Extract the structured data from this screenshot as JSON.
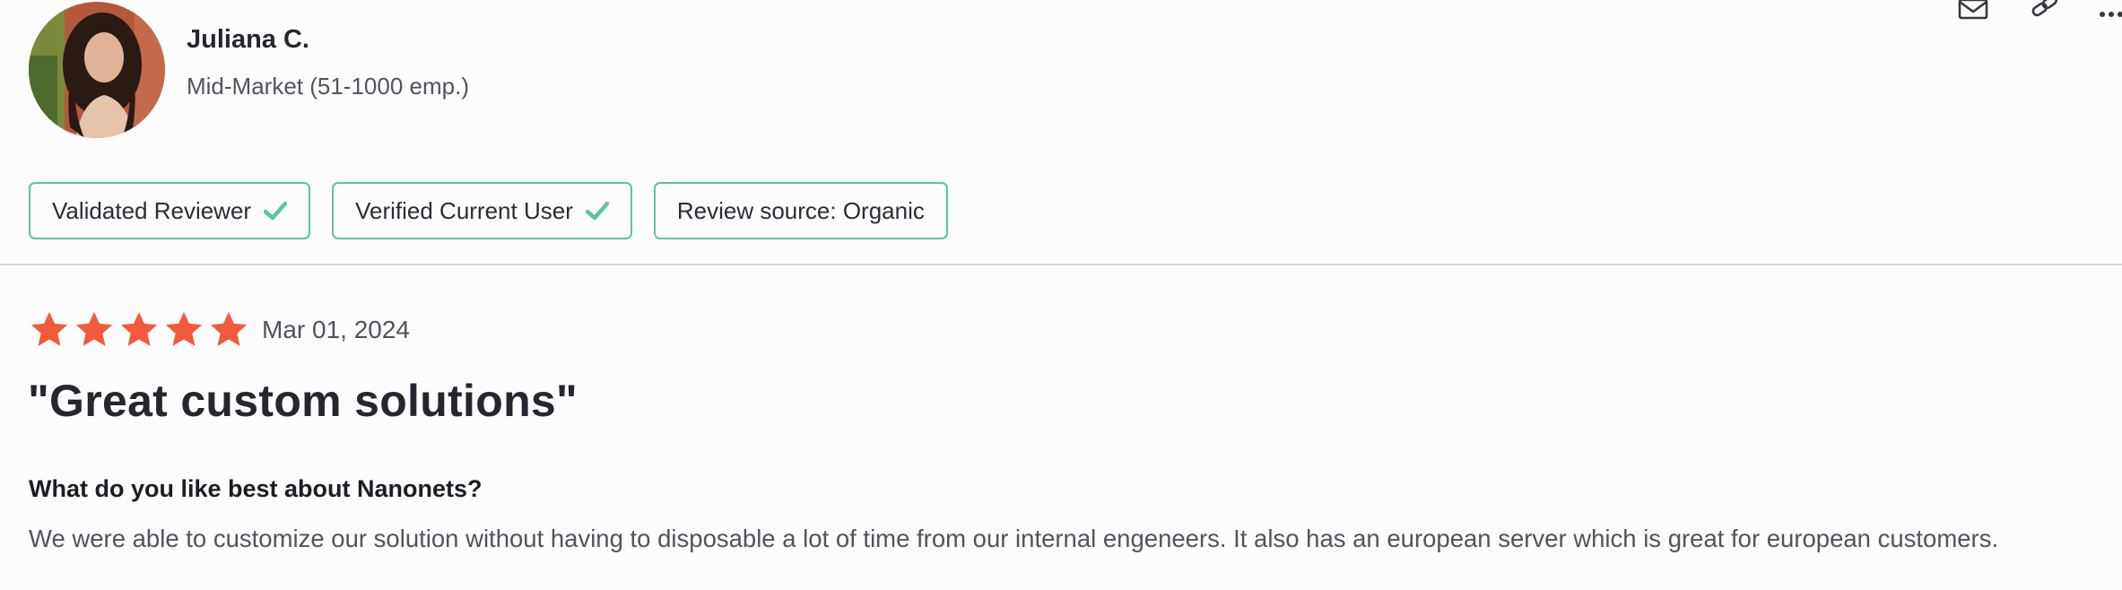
{
  "reviewer": {
    "name": "Juliana C.",
    "segment": "Mid-Market (51-1000 emp.)"
  },
  "actions": {
    "icons": [
      "mail-icon",
      "link-icon",
      "more-icon"
    ]
  },
  "badges": [
    {
      "label": "Validated Reviewer",
      "icon": "check-icon"
    },
    {
      "label": "Verified Current User",
      "icon": "check-icon"
    },
    {
      "label": "Review source: Organic"
    }
  ],
  "review": {
    "rating": 5,
    "rating_max": 5,
    "date": "Mar 01, 2024",
    "title": "\"Great custom solutions\"",
    "question": "What do you like best about Nanonets?",
    "answer": "We were able to customize our solution without having to disposable a lot of time from our internal engeneers. It also has an european server which is great for european customers."
  },
  "colors": {
    "star": "#f15a3a",
    "badge_border": "#5cc4a3",
    "check": "#5cc4a3",
    "divider": "#d6d3d9",
    "text_primary": "#29252e",
    "text_secondary": "#56515c"
  }
}
